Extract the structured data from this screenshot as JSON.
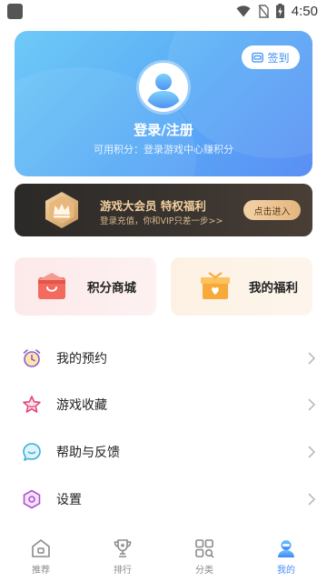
{
  "status_bar": {
    "time": "4:50"
  },
  "profile": {
    "checkin_label": "签到",
    "login_title": "登录/注册",
    "points_text": "可用积分：登录游戏中心赚积分"
  },
  "vip": {
    "title": "游戏大会员 特权福利",
    "subtitle": "登录充值，你和VIP只差一步>>",
    "enter_label": "点击进入"
  },
  "features": [
    {
      "label": "积分商城"
    },
    {
      "label": "我的福利"
    }
  ],
  "menu": [
    {
      "label": "我的预约",
      "icon": "alarm-clock-icon"
    },
    {
      "label": "游戏收藏",
      "icon": "star-icon"
    },
    {
      "label": "帮助与反馈",
      "icon": "feedback-icon"
    },
    {
      "label": "设置",
      "icon": "settings-hexagon-icon"
    }
  ],
  "bottom_nav": [
    {
      "label": "推荐",
      "icon": "home-icon",
      "active": false
    },
    {
      "label": "排行",
      "icon": "trophy-icon",
      "active": false
    },
    {
      "label": "分类",
      "icon": "grid-icon",
      "active": false
    },
    {
      "label": "我的",
      "icon": "profile-icon",
      "active": true
    }
  ],
  "colors": {
    "accent": "#4b8df8",
    "card_gradient_start": "#6fcaf7",
    "card_gradient_end": "#5b8ff4",
    "vip_gold": "#f2cf9e"
  }
}
